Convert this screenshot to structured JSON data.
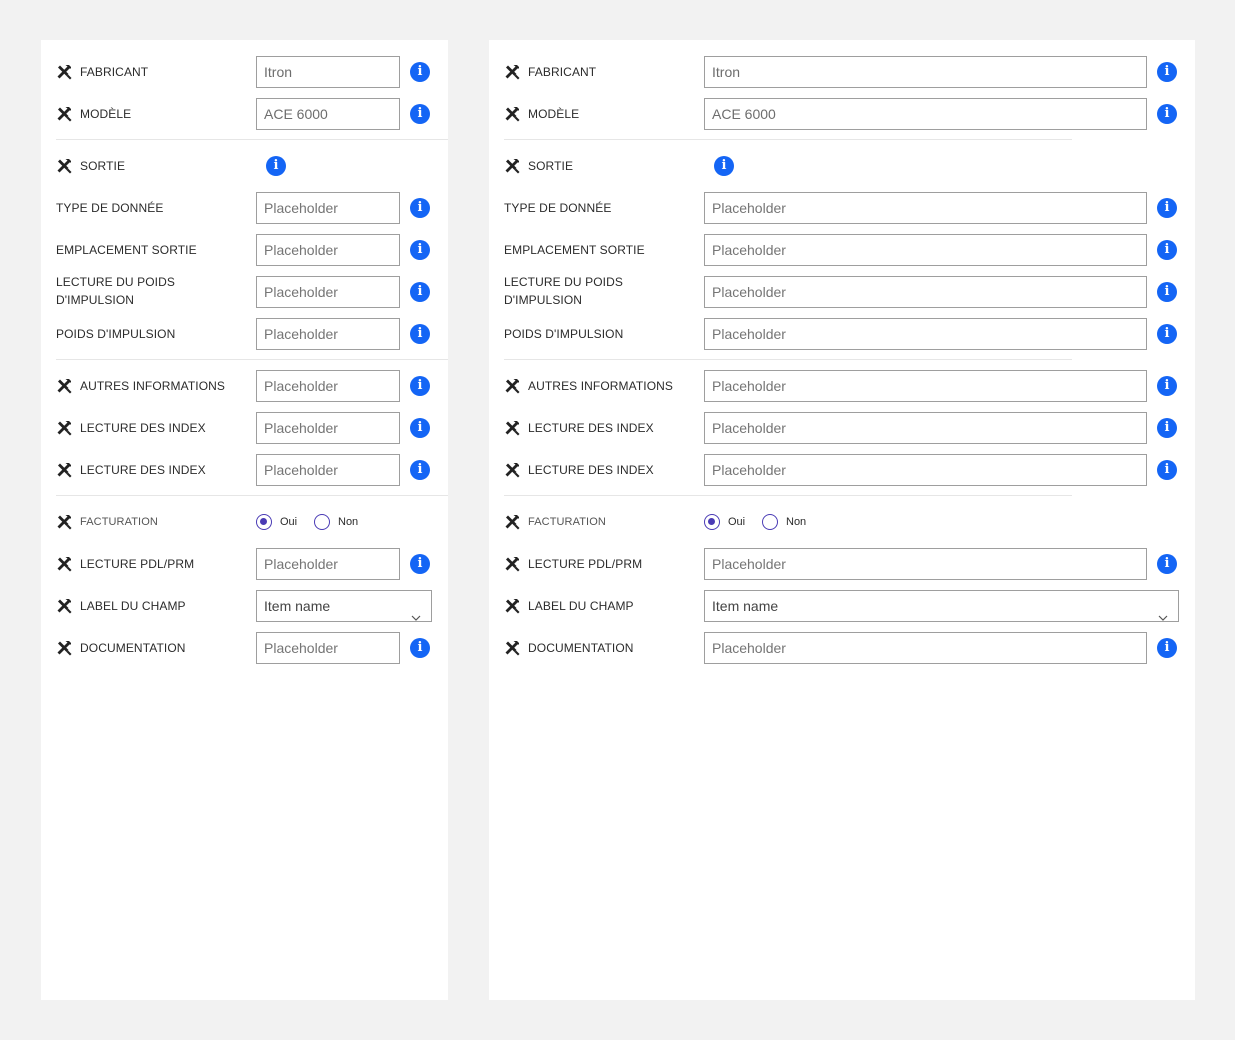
{
  "form": {
    "fabricant": {
      "label": "FABRICANT",
      "value": "Itron"
    },
    "modele": {
      "label": "MODÈLE",
      "value": "ACE 6000"
    },
    "sortie": {
      "label": "SORTIE"
    },
    "type_donnee": {
      "label": "TYPE DE DONNÉE",
      "placeholder": "Placeholder"
    },
    "emplacement_sortie": {
      "label": "EMPLACEMENT SORTIE",
      "placeholder": "Placeholder"
    },
    "lecture_poids_impulsion": {
      "label": "LECTURE DU POIDS D'IMPULSION",
      "placeholder": "Placeholder"
    },
    "poids_impulsion": {
      "label": "POIDS D'IMPULSION",
      "placeholder": "Placeholder"
    },
    "autres_informations": {
      "label": "AUTRES INFORMATIONS",
      "placeholder": "Placeholder"
    },
    "lecture_index_1": {
      "label": "LECTURE DES INDEX",
      "placeholder": "Placeholder"
    },
    "lecture_index_2": {
      "label": "LECTURE DES INDEX",
      "placeholder": "Placeholder"
    },
    "facturation": {
      "label": "FACTURATION",
      "options": [
        "Oui",
        "Non"
      ],
      "selected": "Oui"
    },
    "lecture_pdl_prm": {
      "label": "LECTURE PDL/PRM",
      "placeholder": "Placeholder"
    },
    "label_du_champ": {
      "label": "LABEL DU CHAMP",
      "selected": "Item name"
    },
    "documentation": {
      "label": "DOCUMENTATION",
      "placeholder": "Placeholder"
    }
  },
  "icons": {
    "row_icon": "tools-icon",
    "info_icon": "info-icon",
    "select_icon": "chevron-down-icon"
  },
  "colors": {
    "info_blue": "#1465f5",
    "radio_purple": "#4a3bb5",
    "border_gray": "#9e9e9e",
    "background": "#f2f2f2"
  }
}
